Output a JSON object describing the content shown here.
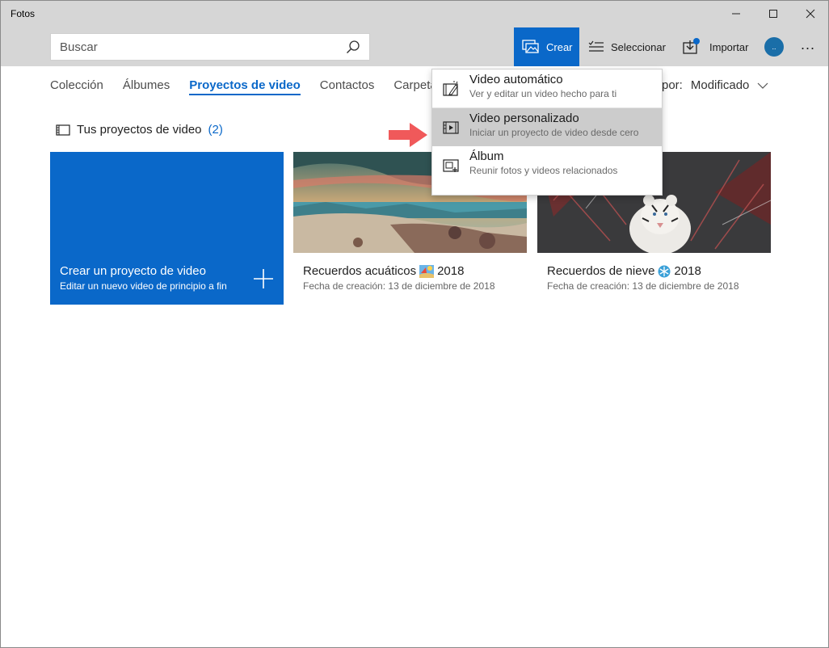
{
  "window": {
    "title": "Fotos"
  },
  "search": {
    "placeholder": "Buscar"
  },
  "toolbar": {
    "crear": "Crear",
    "seleccionar": "Seleccionar",
    "importar": "Importar",
    "avatar_initials": "..",
    "more": "..."
  },
  "nav": {
    "items": [
      {
        "label": "Colección"
      },
      {
        "label": "Álbumes"
      },
      {
        "label": "Proyectos de video"
      },
      {
        "label": "Contactos"
      },
      {
        "label": "Carpeta"
      }
    ],
    "sort_prefix": "por:",
    "sort_value": "Modificado"
  },
  "section": {
    "title": "Tus proyectos de video",
    "count": "(2)"
  },
  "new_tile": {
    "title": "Crear un proyecto de video",
    "subtitle": "Editar un nuevo video de principio a fin"
  },
  "projects": [
    {
      "title": "Recuerdos acuáticos",
      "year": "2018",
      "date": "Fecha de creación: 13 de diciembre de 2018"
    },
    {
      "title": "Recuerdos de nieve",
      "year": "2018",
      "date": "Fecha de creación: 13 de diciembre de 2018"
    }
  ],
  "menu": {
    "items": [
      {
        "title": "Video automático",
        "subtitle": "Ver y editar un video hecho para ti"
      },
      {
        "title": "Video personalizado",
        "subtitle": "Iniciar un proyecto de video desde cero"
      },
      {
        "title": "Álbum",
        "subtitle": "Reunir fotos y videos relacionados"
      }
    ]
  },
  "colors": {
    "accent": "#0a68c9",
    "highlight": "#cccccc",
    "arrow": "#f0595a"
  }
}
